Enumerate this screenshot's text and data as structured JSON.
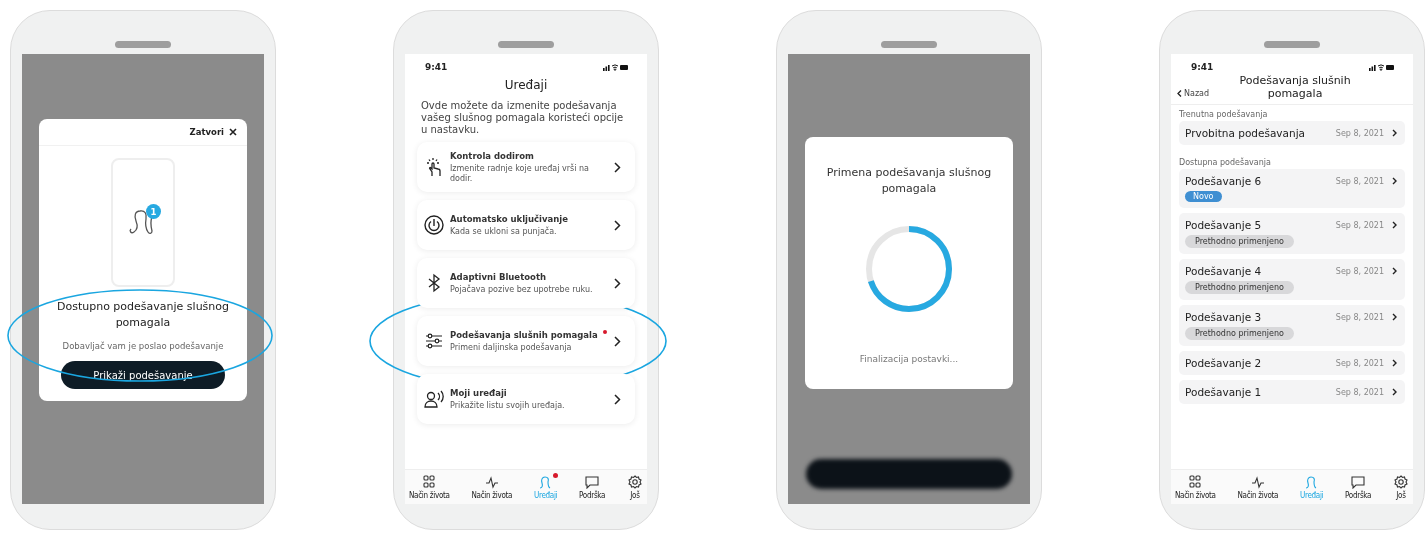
{
  "phones": [
    {
      "kind": "modal",
      "highlighted": true,
      "modal": {
        "close_label": "Zatvori",
        "badge": "1",
        "title": "Dostupno podešavanje slušnog pomagala",
        "message": "Dobavljač vam je poslao podešavanje",
        "button": "Prikaži podešavanje"
      }
    },
    {
      "kind": "devices",
      "highlighted": true,
      "time": "9:41",
      "title": "Uređaji",
      "intro": "Ovde možete da izmenite podešavanja vašeg slušnog pomagala koristeći opcije u nastavku.",
      "items": [
        {
          "title": "Kontrola dodirom",
          "subtitle": "Izmenite radnje koje uređaj vrši na dodir.",
          "notification": false
        },
        {
          "title": "Automatsko uključivanje",
          "subtitle": "Kada se ukloni sa punjača.",
          "notification": false
        },
        {
          "title": "Adaptivni Bluetooth",
          "subtitle": "Pojačava pozive bez upotrebe ruku.",
          "notification": false
        },
        {
          "title": "Podešavanja slušnih pomagala",
          "subtitle": "Primeni daljinska podešavanja",
          "notification": true
        },
        {
          "title": "Moji uređaji",
          "subtitle": "Prikažite listu svojih uređaja.",
          "notification": false
        }
      ],
      "tabs": [
        {
          "label": "Način života",
          "selected": false,
          "notification": false
        },
        {
          "label": "Način života",
          "selected": false,
          "notification": false
        },
        {
          "label": "Uređaji",
          "selected": true,
          "notification": true
        },
        {
          "label": "Podrška",
          "selected": false,
          "notification": false
        },
        {
          "label": "Još",
          "selected": false,
          "notification": false
        }
      ]
    },
    {
      "kind": "progress",
      "title": "Primena podešavanja slušnog pomagala",
      "level": 0.7,
      "status": "Finalizacija postavki..."
    },
    {
      "kind": "settings",
      "time": "9:41",
      "back": "Nazad",
      "title": "Podešavanja slušnih pomagala",
      "current_label": "Trenutna podešavanja",
      "current": {
        "name": "Prvobitna podešavanja",
        "date": "Sep 8, 2021"
      },
      "available_label": "Dostupna podešavanja",
      "items": [
        {
          "name": "Podešavanje 6",
          "date": "Sep 8, 2021",
          "tag": {
            "kind": "new",
            "label": "Novo"
          }
        },
        {
          "name": "Podešavanje 5",
          "date": "Sep 8, 2021",
          "tag": {
            "kind": "previous",
            "label": "Prethodno primenjeno"
          }
        },
        {
          "name": "Podešavanje 4",
          "date": "Sep 8, 2021",
          "tag": {
            "kind": "previous",
            "label": "Prethodno primenjeno"
          }
        },
        {
          "name": "Podešavanje 3",
          "date": "Sep 8, 2021",
          "tag": {
            "kind": "previous",
            "label": "Prethodno primenjeno"
          }
        },
        {
          "name": "Podešavanje 2",
          "date": "Sep 8, 2021"
        },
        {
          "name": "Podešavanje 1",
          "date": "Sep 8, 2021"
        }
      ],
      "tabs": [
        {
          "label": "Način života",
          "selected": false,
          "notification": false
        },
        {
          "label": "Način života",
          "selected": false,
          "notification": false
        },
        {
          "label": "Uređaji",
          "selected": true,
          "notification": false
        },
        {
          "label": "Podrška",
          "selected": false,
          "notification": false
        },
        {
          "label": "Još",
          "selected": false,
          "notification": false
        }
      ]
    }
  ]
}
